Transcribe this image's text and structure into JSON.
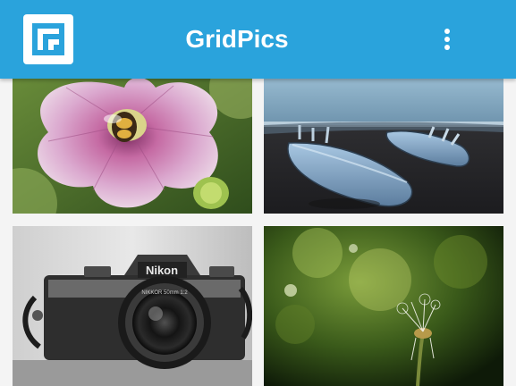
{
  "app": {
    "title": "GridPics",
    "logo_icon": "gridpics-logo-icon",
    "menu_icon": "more-vert-icon",
    "accent_color": "#2aa3dc"
  },
  "gallery": {
    "photos": [
      {
        "subject": "Bee on pink flower"
      },
      {
        "subject": "Surfboards on beach"
      },
      {
        "subject": "Vintage camera"
      },
      {
        "subject": "Dandelion seed head"
      }
    ],
    "camera_brand_text": "Nikon",
    "camera_lens_text": "NIKKOR 50mm 1:2"
  }
}
